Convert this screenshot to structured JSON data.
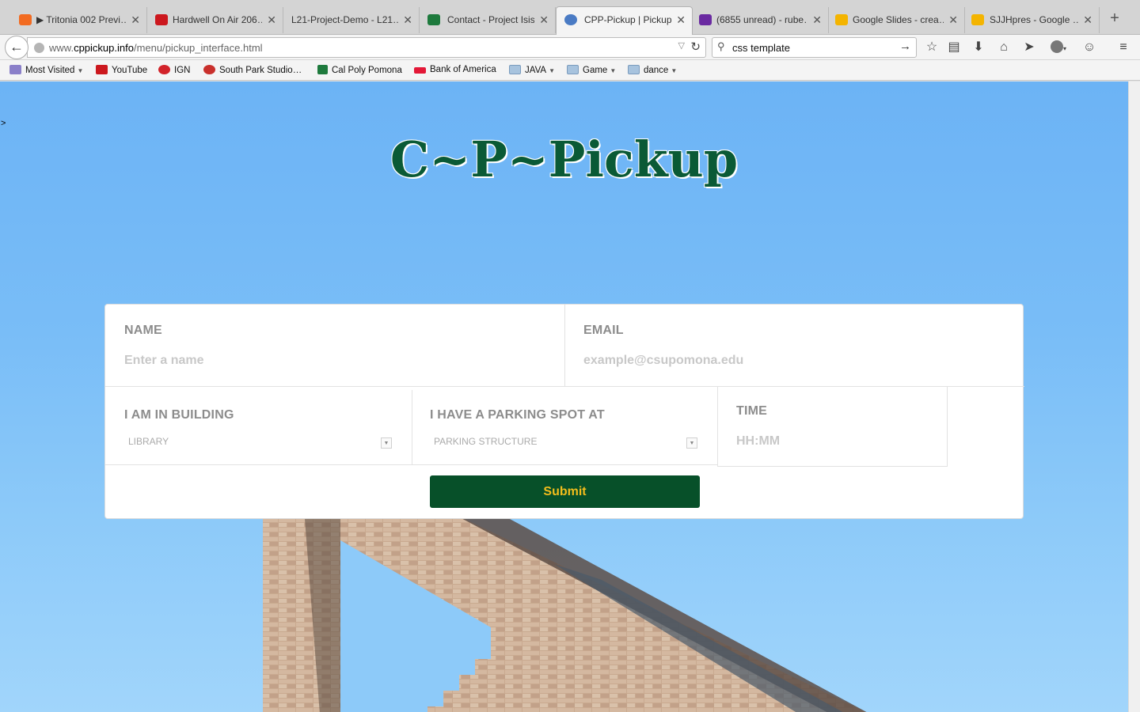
{
  "tabs": [
    {
      "label": "▶ Tritonia 002 Previ…",
      "color": "#f26b21"
    },
    {
      "label": "Hardwell On Air 206…",
      "color": "#cc181e"
    },
    {
      "label": "L21-Project-Demo - L21…",
      "color": "#d4d4d4"
    },
    {
      "label": "Contact - Project Isis",
      "color": "#1e7a3d"
    },
    {
      "label": "CPP-Pickup | Pickup",
      "color": "#4a7bc4"
    },
    {
      "label": "(6855 unread) - rube…",
      "color": "#6a2aa1"
    },
    {
      "label": "Google Slides - crea…",
      "color": "#f4b400"
    },
    {
      "label": "SJJHpres - Google …",
      "color": "#f4b400"
    }
  ],
  "newtab_symbol": "+",
  "close_symbol": "✕",
  "url": {
    "prefix": "www.",
    "host": "cppickup.info",
    "path": "/menu/pickup_interface.html"
  },
  "search": {
    "value": "css template"
  },
  "bookmarks": [
    {
      "label": "Most Visited",
      "caret": true,
      "color": "#8a7fc9"
    },
    {
      "label": "YouTube",
      "caret": false,
      "color": "#cc181e"
    },
    {
      "label": "IGN",
      "caret": false,
      "color": "#d2232a"
    },
    {
      "label": "South Park Studio…",
      "caret": false,
      "color": "#c9302c"
    },
    {
      "label": "Cal Poly Pomona",
      "caret": false,
      "color": "#1e7a3d"
    },
    {
      "label": "Bank of America",
      "caret": false,
      "color": "#e31837"
    },
    {
      "label": "JAVA",
      "caret": true,
      "color": "folder"
    },
    {
      "label": "Game",
      "caret": true,
      "color": "folder"
    },
    {
      "label": "dance",
      "caret": true,
      "color": "folder"
    }
  ],
  "page": {
    "stray_char": ">",
    "brand_title": "C~P~Pickup",
    "form": {
      "name_label": "NAME",
      "name_placeholder": "Enter a name",
      "email_label": "EMAIL",
      "email_placeholder": "example@csupomona.edu",
      "building_label": "I AM IN BUILDING",
      "building_value": "LIBRARY",
      "parking_label": "I HAVE A PARKING SPOT AT",
      "parking_value": "PARKING STRUCTURE",
      "time_label": "TIME",
      "time_placeholder": "HH:MM",
      "submit_label": "Submit"
    }
  },
  "colors": {
    "brand_green": "#075029",
    "submit_text": "#f2bd1c",
    "sky": "#79bdf7"
  }
}
